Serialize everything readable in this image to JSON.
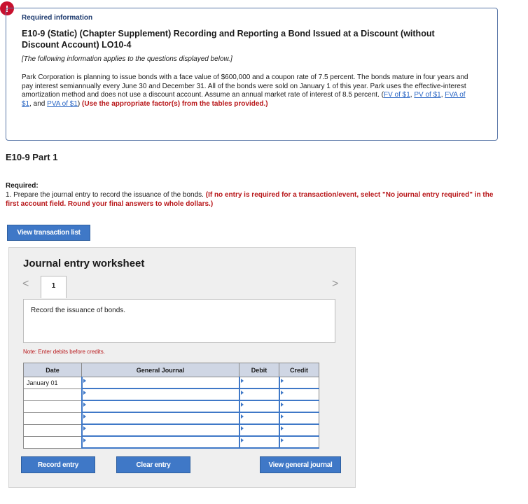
{
  "alert": {
    "glyph": "!"
  },
  "info": {
    "label": "Required information",
    "title": "E10-9 (Static) (Chapter Supplement) Recording and Reporting a Bond Issued at a Discount (without Discount Account) LO10-4",
    "intro": "[The following information applies to the questions displayed below.]",
    "paragraph": "Park Corporation is planning to issue bonds with a face value of $600,000 and a coupon rate of 7.5 percent. The bonds mature in four years and pay interest semiannually every June 30 and December 31. All of the bonds were sold on January 1 of this year. Park uses the effective-interest amortization method and does not use a discount account. Assume an annual market rate of interest of 8.5 percent.",
    "links": [
      "FV of $1",
      "PV of $1",
      "FVA of $1",
      "PVA of $1"
    ],
    "link_sep1": ", ",
    "link_sep2": ", ",
    "link_sep3": ", and ",
    "instruction": "(Use the appropriate factor(s) from the tables provided.)"
  },
  "part": {
    "title": "E10-9 Part 1"
  },
  "required": {
    "label": "Required:",
    "text": "1. Prepare the journal entry to record the issuance of the bonds.",
    "instruction": "(If no entry is required for a transaction/event, select \"No journal entry required\" in the first account field. Round your final answers to whole dollars.)"
  },
  "buttons": {
    "view_transactions": "View transaction list",
    "record_entry": "Record entry",
    "clear_entry": "Clear entry",
    "view_general_journal": "View general journal"
  },
  "worksheet": {
    "title": "Journal entry worksheet",
    "tab_number": "1",
    "nav_prev": "<",
    "nav_next": ">",
    "description": "Record the issuance of bonds.",
    "note": "Note: Enter debits before credits."
  },
  "table": {
    "headers": [
      "Date",
      "General Journal",
      "Debit",
      "Credit"
    ],
    "rows": [
      {
        "date": "January 01"
      },
      {
        "date": ""
      },
      {
        "date": ""
      },
      {
        "date": ""
      },
      {
        "date": ""
      },
      {
        "date": ""
      }
    ]
  },
  "colors": {
    "accent": "#3f78c7",
    "alert": "#c8102e",
    "highlight_text": "#b8171a"
  }
}
